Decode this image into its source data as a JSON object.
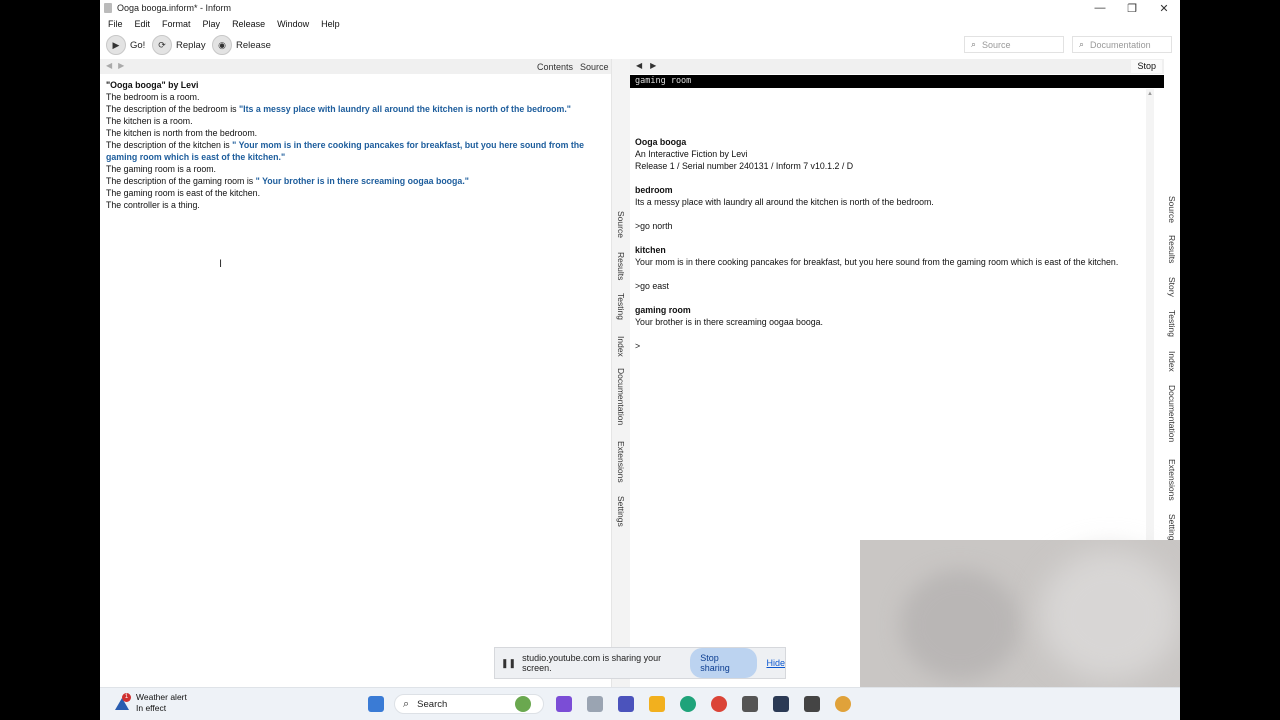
{
  "window": {
    "title": "Ooga booga.inform* - Inform",
    "controls": {
      "minimize": "—",
      "restore": "❐",
      "close": "✕"
    }
  },
  "menu": [
    "File",
    "Edit",
    "Format",
    "Play",
    "Release",
    "Window",
    "Help"
  ],
  "toolbar": {
    "go": "Go!",
    "replay": "Replay",
    "release": "Release",
    "source_search_placeholder": "Source",
    "docs_search_placeholder": "Documentation"
  },
  "left_header": {
    "contents": "Contents",
    "source": "Source"
  },
  "source_lines": [
    {
      "text": "\"Ooga booga\" by Levi",
      "type": "heading"
    },
    {
      "text": "The bedroom is a room.",
      "type": "plain"
    },
    {
      "pre": "The description of the bedroom is ",
      "quote": "\"Its a messy place with laundry all around the kitchen is north of the bedroom.\"",
      "type": "desc"
    },
    {
      "text": "The kitchen is a room.",
      "type": "plain"
    },
    {
      "text": "The kitchen is north from the bedroom.",
      "type": "plain"
    },
    {
      "pre": "The description of the kitchen is ",
      "quote": "\" Your mom is in there cooking pancakes for breakfast, but you here sound from the gaming room which is east of the kitchen.\"",
      "type": "desc"
    },
    {
      "text": "The gaming room is a room.",
      "type": "plain"
    },
    {
      "pre": "The description of the gaming room is ",
      "quote": "\" Your brother is in there screaming oogaa booga.\"",
      "type": "desc"
    },
    {
      "text": "The gaming room is east of the kitchen.",
      "type": "plain"
    },
    {
      "text": "The controller is a thing.",
      "type": "plain"
    }
  ],
  "left_vtabs": [
    "Source",
    "Results",
    "Testing",
    "Index",
    "Documentation",
    "Extensions",
    "Settings"
  ],
  "right_vtabs": [
    "Source",
    "Results",
    "Story",
    "Testing",
    "Index",
    "Documentation",
    "Extensions",
    "Settings"
  ],
  "right_header": {
    "stop": "Stop"
  },
  "status_line": "gaming room",
  "story": {
    "title": "Ooga booga",
    "byline": "An Interactive Fiction by Levi",
    "release": "Release 1 / Serial number 240131 / Inform 7 v10.1.2 / D",
    "room1": "bedroom",
    "room1_desc": "Its a messy place with laundry all around the kitchen is north of the bedroom.",
    "cmd1": ">go north",
    "room2": "kitchen",
    "room2_desc": " Your mom is in there cooking pancakes for breakfast, but you here sound from the gaming room which is east of the kitchen.",
    "cmd2": ">go east",
    "room3": "gaming room",
    "room3_desc": " Your brother is in there screaming oogaa booga.",
    "prompt": ">"
  },
  "share_bar": {
    "message": "studio.youtube.com is sharing your screen.",
    "stop": "Stop sharing",
    "hide": "Hide"
  },
  "taskbar": {
    "weather_title": "Weather alert",
    "weather_sub": "In effect",
    "weather_badge": "1",
    "search": "Search"
  },
  "colors": {
    "quote": "#1d5d9c",
    "status_bg": "#000000",
    "share_btn": "#bcd3f0"
  }
}
